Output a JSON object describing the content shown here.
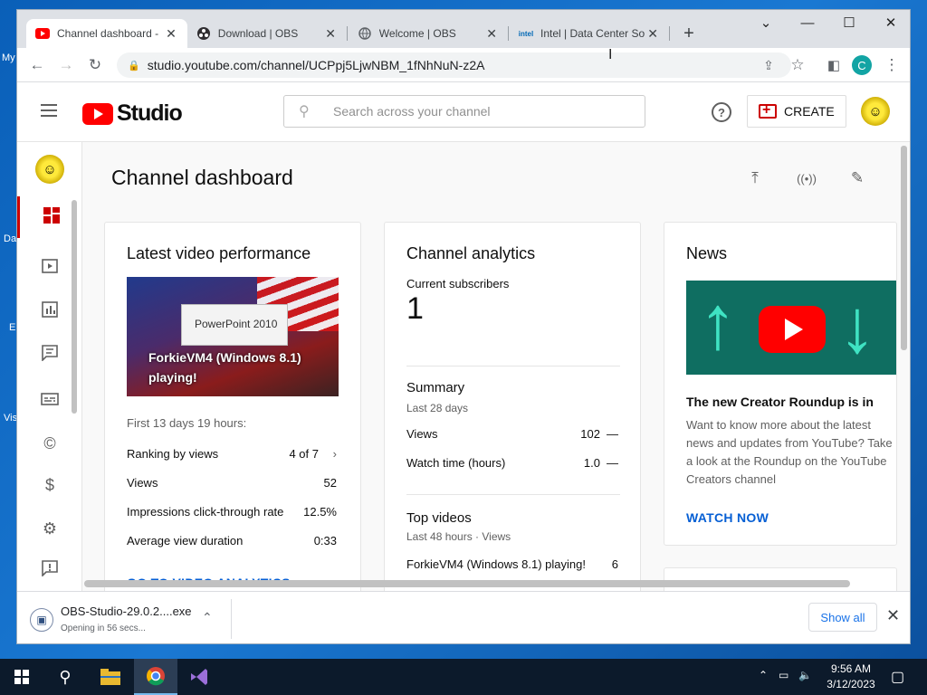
{
  "desktop": {
    "fragments": [
      "My",
      "Da",
      "E",
      "Vis"
    ]
  },
  "browser": {
    "tabs": [
      {
        "label": "Channel dashboard -",
        "icon": "youtube-icon"
      },
      {
        "label": "Download | OBS",
        "icon": "obs-icon"
      },
      {
        "label": "Welcome | OBS",
        "icon": "globe-icon"
      },
      {
        "label": "Intel | Data Center So",
        "icon": "intel-icon",
        "icon_text": "intel"
      }
    ],
    "url": "studio.youtube.com/channel/UCPpj5LjwNBM_1fNhNuN-z2A",
    "profile_initial": "C"
  },
  "studio": {
    "logo_text": "Studio",
    "search_placeholder": "Search across your channel",
    "help_symbol": "?",
    "create_label": "CREATE",
    "page_title": "Channel dashboard"
  },
  "latest_video": {
    "title": "Latest video performance",
    "thumb_overlay_text": "ForkieVM4 (Windows 8.1) playing!",
    "thumb_app_text": "PowerPoint 2010",
    "period": "First 13 days 19 hours:",
    "stats": [
      {
        "label": "Ranking by views",
        "value": "4 of 7"
      },
      {
        "label": "Views",
        "value": "52"
      },
      {
        "label": "Impressions click-through rate",
        "value": "12.5%"
      },
      {
        "label": "Average view duration",
        "value": "0:33"
      }
    ],
    "link": "GO TO VIDEO ANALYTICS"
  },
  "channel_analytics": {
    "title": "Channel analytics",
    "subscribers_label": "Current subscribers",
    "subscribers_value": "1",
    "summary_title": "Summary",
    "summary_period": "Last 28 days",
    "summary_rows": [
      {
        "label": "Views",
        "value": "102",
        "trend": "—"
      },
      {
        "label": "Watch time (hours)",
        "value": "1.0",
        "trend": "—"
      }
    ],
    "top_videos_title": "Top videos",
    "top_videos_period": "Last 48 hours · Views",
    "top_videos": [
      {
        "title": "ForkieVM4 (Windows 8.1) playing!",
        "views": "6"
      }
    ]
  },
  "news": {
    "title": "News",
    "headline": "The new Creator Roundup is in",
    "body": "Want to know more about the latest news and updates from YouTube? Take a look at the Roundup on the YouTube Creators channel",
    "link": "WATCH NOW"
  },
  "download": {
    "filename": "OBS-Studio-29.0.2....exe",
    "status": "Opening in 56 secs...",
    "show_all": "Show all"
  },
  "taskbar": {
    "time": "9:56 AM",
    "date": "3/12/2023"
  }
}
